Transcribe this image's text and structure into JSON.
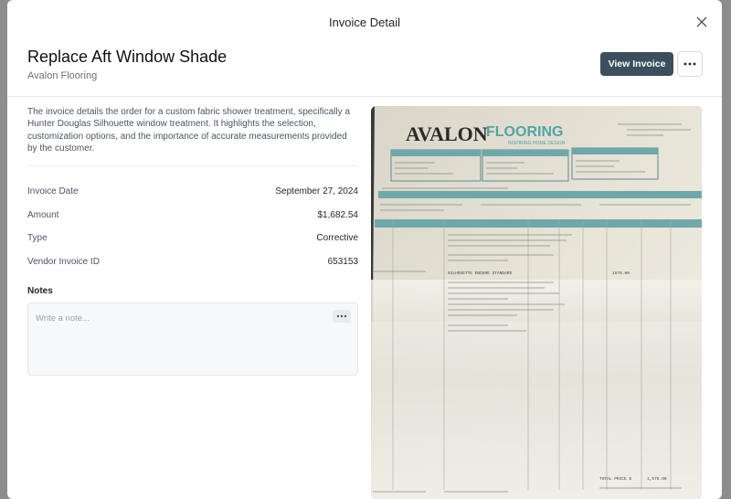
{
  "modal": {
    "title": "Invoice Detail"
  },
  "invoice": {
    "title": "Replace Aft Window Shade",
    "vendor": "Avalon Flooring",
    "view_button": "View Invoice",
    "description": "The invoice details the order for a custom fabric shower treatment, specifically a Hunter Douglas Silhouette window treatment. It highlights the selection, customization options, and the importance of accurate measurements provided by the customer.",
    "fields": [
      {
        "label": "Invoice Date",
        "value": "September 27, 2024"
      },
      {
        "label": "Amount",
        "value": "$1,682.54"
      },
      {
        "label": "Type",
        "value": "Corrective"
      },
      {
        "label": "Vendor Invoice ID",
        "value": "653153"
      }
    ]
  },
  "notes": {
    "label": "Notes",
    "placeholder": "Write a note..."
  },
  "document_image": {
    "brand_a": "AVALON",
    "brand_b": "FLOORING",
    "tagline": "INSPIRING HOME DESIGN",
    "item_desc": "SILHOUETTE ENDURE STANDARD",
    "amount_1": "1578.00",
    "total_label": "TOTAL PRICE $",
    "total_value": "1,578.00"
  },
  "icons": {
    "close": "close-icon",
    "more": "more-horizontal-icon"
  },
  "colors": {
    "primary_button": "#3d4f5c",
    "backdrop": "#8d8d8d"
  }
}
